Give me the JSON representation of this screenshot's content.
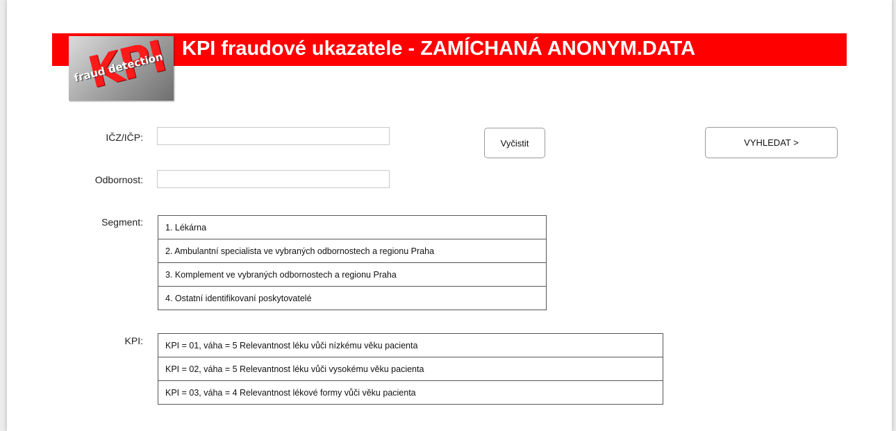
{
  "header": {
    "title": "KPI fraudové ukazatele - ZAMÍCHANÁ ANONYM.DATA",
    "logo": {
      "big_text": "KPI",
      "small_text": "fraud detection"
    },
    "banner_color": "#fe0000"
  },
  "form": {
    "icz": {
      "label": "IČZ/IČP:",
      "value": "",
      "placeholder": ""
    },
    "odbornost": {
      "label": "Odbornost:",
      "value": "",
      "placeholder": ""
    },
    "segment": {
      "label": "Segment:",
      "items": [
        "1. Lékárna",
        "2. Ambulantní specialista ve vybraných odbornostech a regionu Praha",
        "3. Komplement ve vybraných odbornostech a regionu Praha",
        "4. Ostatní identifikovaní poskytovatelé"
      ]
    },
    "kpi": {
      "label": "KPI:",
      "items": [
        "KPI = 01, váha = 5 Relevantnost léku vůči nízkému věku pacienta",
        "KPI = 02, váha = 5 Relevantnost léku vůči vysokému věku pacienta",
        "KPI = 03, váha = 4 Relevantnost lékové formy vůči věku pacienta"
      ]
    }
  },
  "buttons": {
    "clear_label": "Vyčistit",
    "search_label": "VYHLEDAT >"
  }
}
